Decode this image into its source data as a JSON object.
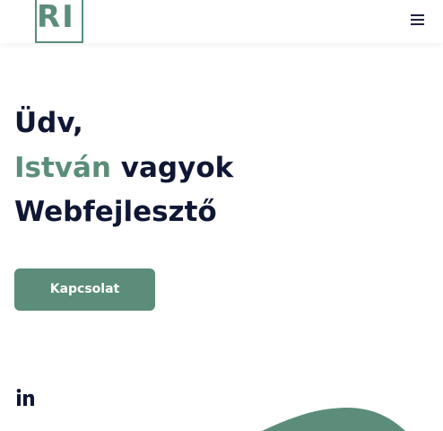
{
  "header": {
    "logo_text": "RI",
    "menu_icon": "hamburger-menu-icon"
  },
  "hero": {
    "greeting": "Üdv,",
    "name": "István",
    "name_suffix": " vagyok",
    "role": "Webfejlesztő"
  },
  "cta": {
    "label": "Kapcsolat"
  },
  "social": {
    "linkedin_icon": "linkedin-icon"
  },
  "colors": {
    "accent": "#5b8d7a",
    "text_dark": "#0f1734",
    "background": "#ffffff"
  }
}
